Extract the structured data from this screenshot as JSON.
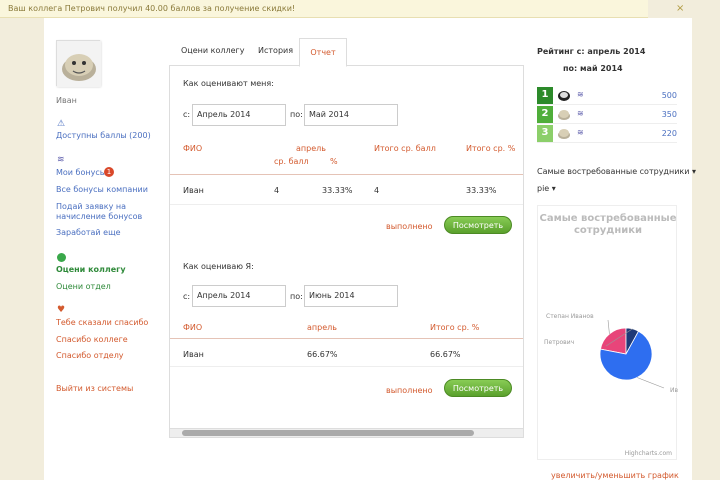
{
  "notification": {
    "text": "Ваш коллега Петрович получил 40.00 баллов за получение скидки!",
    "close": "×"
  },
  "sidebar": {
    "username": "Иван",
    "points_available": "Доступны баллы (200)",
    "my_bonuses": "Мои бонусы",
    "bonus_badge": "1",
    "all_company_bonuses": "Все бонусы компании",
    "submit_request_line1": "Подай заявку на",
    "submit_request_line2": "начисление бонусов",
    "earn_more": "Заработай еще",
    "rate_colleague": "Оцени коллегу",
    "rate_department": "Оцени отдел",
    "thanked_you": "Тебе сказали спасибо",
    "thank_colleague": "Спасибо коллеге",
    "thank_department": "Спасибо отделу",
    "logout": "Выйти из системы"
  },
  "tabs": [
    {
      "label": "Оцени коллегу"
    },
    {
      "label": "История"
    },
    {
      "label": "Отчет"
    }
  ],
  "report": {
    "section1_title": "Как оценивают меня:",
    "from_label": "с:",
    "to_label": "по:",
    "from1": "Апрель 2014",
    "to1": "Май 2014",
    "t1_headers": {
      "fio": "ФИО",
      "april": "апрель",
      "avg_score": "ср. балл",
      "percent": "%",
      "total_avg": "Итого ср. балл",
      "total_pct": "Итого ср. %"
    },
    "t1_row": {
      "name": "Иван",
      "score": "4",
      "pct": "33.33%",
      "total_score": "4",
      "total_pct": "33.33%"
    },
    "status1": "выполнено",
    "view_btn1": "Посмотреть",
    "section2_title": "Как оцениваю Я:",
    "from2": "Апрель 2014",
    "to2": "Июнь 2014",
    "t2_headers": {
      "fio": "ФИО",
      "april": "апрель",
      "total_pct": "Итого ср. %"
    },
    "t2_row": {
      "name": "Иван",
      "april": "66.67%",
      "total_pct": "66.67%"
    },
    "status2": "выполнено",
    "view_btn2": "Посмотреть"
  },
  "rating": {
    "title_line1": "Рейтинг с: апрель 2014",
    "title_line2": "по: май 2014",
    "rows": [
      {
        "rank": "1",
        "value": "500"
      },
      {
        "rank": "2",
        "value": "350"
      },
      {
        "rank": "3",
        "value": "220"
      }
    ],
    "coin_icon": "≋"
  },
  "chart_selector": {
    "line1": "Самые востребованные сотрудники ▾",
    "line2": "pie ▾"
  },
  "chart_data": {
    "type": "pie",
    "title": "Самые востребованные сотрудники",
    "labels": [
      "Степан Иванов",
      "Петрович",
      "Ива"
    ],
    "values": [
      22,
      8,
      70
    ],
    "colors": [
      "#e8457a",
      "#1f3a78",
      "#2e6ef0"
    ],
    "credits": "Highcharts.com"
  },
  "zoom_link": "увеличить/уменьшить график"
}
